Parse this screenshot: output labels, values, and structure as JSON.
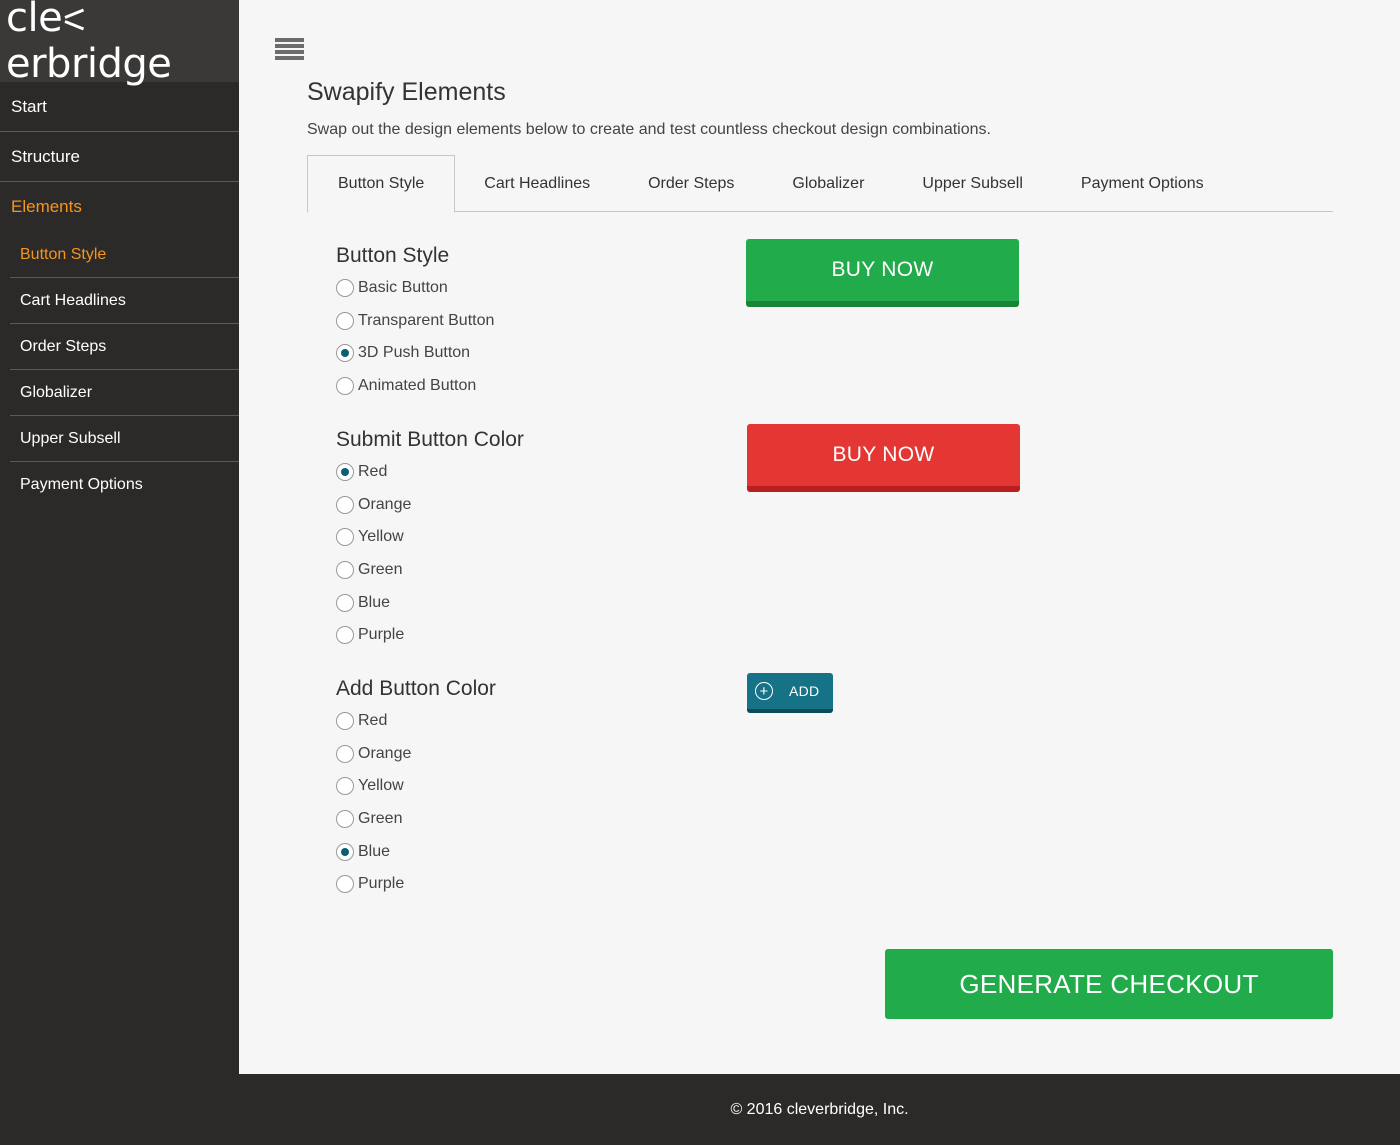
{
  "brand": {
    "logo_pre": "cle",
    "logo_post": "erbridge"
  },
  "sidebar": {
    "top_items": [
      {
        "label": "Start"
      },
      {
        "label": "Structure"
      },
      {
        "label": "Elements"
      }
    ],
    "sub_items": [
      {
        "label": "Button Style"
      },
      {
        "label": "Cart Headlines"
      },
      {
        "label": "Order Steps"
      },
      {
        "label": "Globalizer"
      },
      {
        "label": "Upper Subsell"
      },
      {
        "label": "Payment Options"
      }
    ]
  },
  "main": {
    "title": "Swapify Elements",
    "description": "Swap out the design elements below to create and test countless checkout design combinations.",
    "tabs": [
      {
        "label": "Button Style"
      },
      {
        "label": "Cart Headlines"
      },
      {
        "label": "Order Steps"
      },
      {
        "label": "Globalizer"
      },
      {
        "label": "Upper Subsell"
      },
      {
        "label": "Payment Options"
      }
    ],
    "button_style": {
      "heading": "Button Style",
      "options": [
        "Basic Button",
        "Transparent Button",
        "3D Push Button",
        "Animated Button"
      ],
      "selected": "3D Push Button",
      "preview_label": "BUY NOW"
    },
    "submit_color": {
      "heading": "Submit Button Color",
      "options": [
        "Red",
        "Orange",
        "Yellow",
        "Green",
        "Blue",
        "Purple"
      ],
      "selected": "Red",
      "preview_label": "BUY NOW"
    },
    "add_color": {
      "heading": "Add Button Color",
      "options": [
        "Red",
        "Orange",
        "Yellow",
        "Green",
        "Blue",
        "Purple"
      ],
      "selected": "Blue",
      "preview_label": "ADD"
    },
    "generate_label": "GENERATE CHECKOUT"
  },
  "footer": {
    "text": "© 2016 cleverbridge, Inc."
  },
  "colors": {
    "accent_orange": "#f7941d",
    "green": "#22ab4a",
    "red": "#e43733",
    "teal": "#157287",
    "sidebar_bg": "#2b2a28"
  }
}
